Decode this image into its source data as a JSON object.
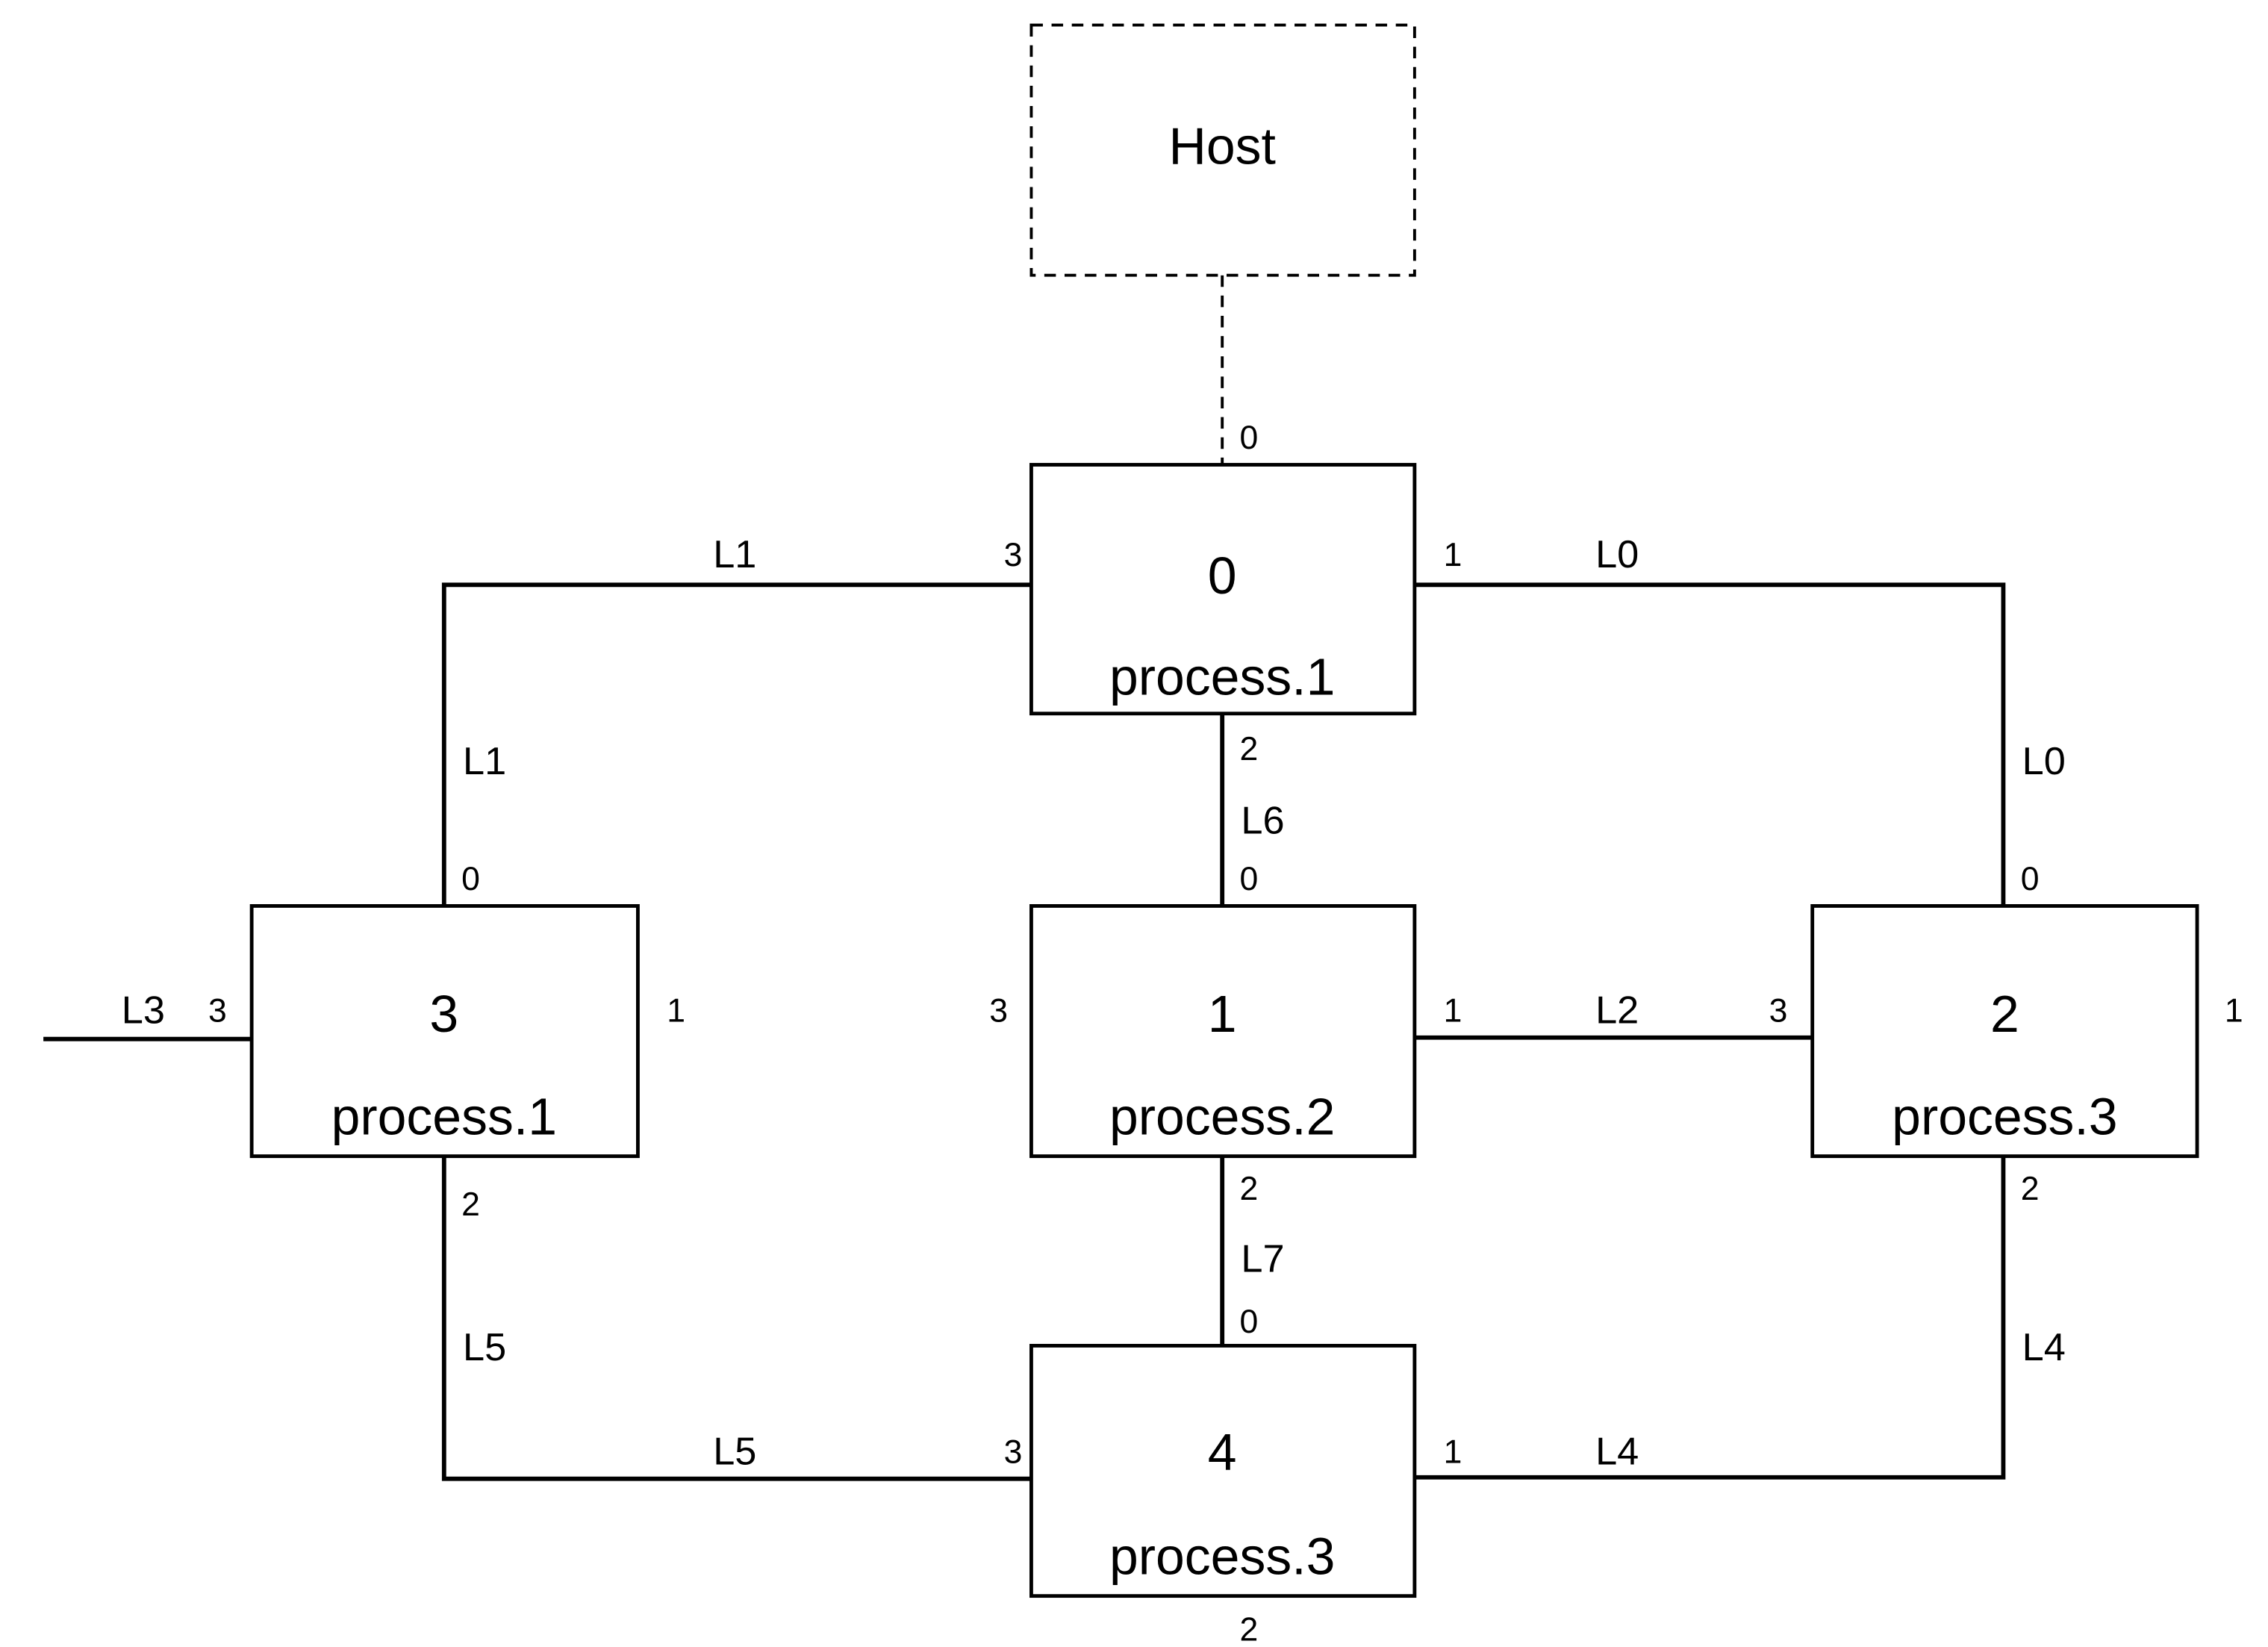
{
  "host": {
    "label": "Host",
    "port": "0"
  },
  "nodes": [
    {
      "id": "0",
      "process": "process.1",
      "ports": {
        "p1": "1",
        "p2": "2",
        "p3": "3"
      }
    },
    {
      "id": "1",
      "process": "process.2",
      "ports": {
        "p0": "0",
        "p1": "1",
        "p2": "2",
        "p3": "3"
      }
    },
    {
      "id": "2",
      "process": "process.3",
      "ports": {
        "p0": "0",
        "p1": "1",
        "p2": "2",
        "p3": "3"
      }
    },
    {
      "id": "3",
      "process": "process.1",
      "ports": {
        "p0": "0",
        "p1": "1",
        "p2": "2",
        "p3": "3"
      }
    },
    {
      "id": "4",
      "process": "process.3",
      "ports": {
        "p0": "0",
        "p1": "1",
        "p2": "2",
        "p3": "3"
      }
    }
  ],
  "links": {
    "L0": "L0",
    "L1": "L1",
    "L2": "L2",
    "L3": "L3",
    "L4": "L4",
    "L5": "L5",
    "L6": "L6",
    "L7": "L7"
  }
}
